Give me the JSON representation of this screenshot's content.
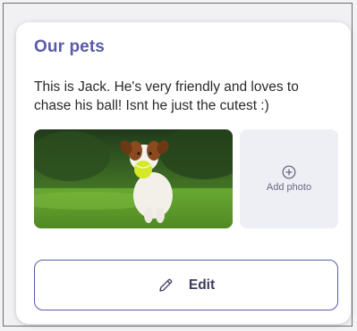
{
  "card": {
    "title": "Our pets",
    "description": "This is Jack. He's very friendly and loves to chase his ball! Isnt he just the cutest :)"
  },
  "photo": {
    "subject": "dog-with-tennis-ball"
  },
  "add_photo": {
    "label": "Add photo",
    "icon": "plus-circle-icon"
  },
  "edit_button": {
    "label": "Edit",
    "icon": "pencil-icon"
  },
  "colors": {
    "accent": "#5a5aaa",
    "text": "#2a2a2a",
    "placeholder_bg": "#eeeef5"
  }
}
